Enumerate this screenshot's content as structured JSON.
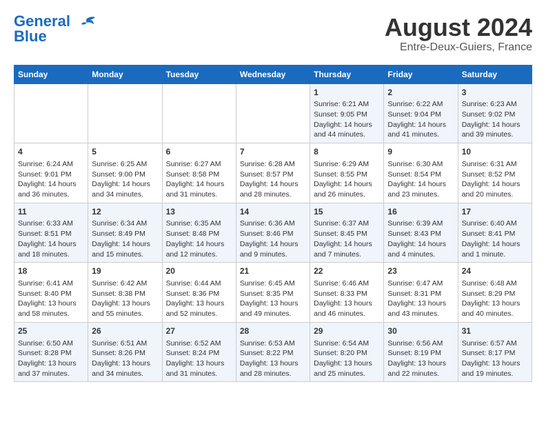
{
  "logo": {
    "line1": "General",
    "line2": "Blue"
  },
  "title": "August 2024",
  "subtitle": "Entre-Deux-Guiers, France",
  "weekdays": [
    "Sunday",
    "Monday",
    "Tuesday",
    "Wednesday",
    "Thursday",
    "Friday",
    "Saturday"
  ],
  "weeks": [
    [
      {
        "day": "",
        "content": ""
      },
      {
        "day": "",
        "content": ""
      },
      {
        "day": "",
        "content": ""
      },
      {
        "day": "",
        "content": ""
      },
      {
        "day": "1",
        "content": "Sunrise: 6:21 AM\nSunset: 9:05 PM\nDaylight: 14 hours and 44 minutes."
      },
      {
        "day": "2",
        "content": "Sunrise: 6:22 AM\nSunset: 9:04 PM\nDaylight: 14 hours and 41 minutes."
      },
      {
        "day": "3",
        "content": "Sunrise: 6:23 AM\nSunset: 9:02 PM\nDaylight: 14 hours and 39 minutes."
      }
    ],
    [
      {
        "day": "4",
        "content": "Sunrise: 6:24 AM\nSunset: 9:01 PM\nDaylight: 14 hours and 36 minutes."
      },
      {
        "day": "5",
        "content": "Sunrise: 6:25 AM\nSunset: 9:00 PM\nDaylight: 14 hours and 34 minutes."
      },
      {
        "day": "6",
        "content": "Sunrise: 6:27 AM\nSunset: 8:58 PM\nDaylight: 14 hours and 31 minutes."
      },
      {
        "day": "7",
        "content": "Sunrise: 6:28 AM\nSunset: 8:57 PM\nDaylight: 14 hours and 28 minutes."
      },
      {
        "day": "8",
        "content": "Sunrise: 6:29 AM\nSunset: 8:55 PM\nDaylight: 14 hours and 26 minutes."
      },
      {
        "day": "9",
        "content": "Sunrise: 6:30 AM\nSunset: 8:54 PM\nDaylight: 14 hours and 23 minutes."
      },
      {
        "day": "10",
        "content": "Sunrise: 6:31 AM\nSunset: 8:52 PM\nDaylight: 14 hours and 20 minutes."
      }
    ],
    [
      {
        "day": "11",
        "content": "Sunrise: 6:33 AM\nSunset: 8:51 PM\nDaylight: 14 hours and 18 minutes."
      },
      {
        "day": "12",
        "content": "Sunrise: 6:34 AM\nSunset: 8:49 PM\nDaylight: 14 hours and 15 minutes."
      },
      {
        "day": "13",
        "content": "Sunrise: 6:35 AM\nSunset: 8:48 PM\nDaylight: 14 hours and 12 minutes."
      },
      {
        "day": "14",
        "content": "Sunrise: 6:36 AM\nSunset: 8:46 PM\nDaylight: 14 hours and 9 minutes."
      },
      {
        "day": "15",
        "content": "Sunrise: 6:37 AM\nSunset: 8:45 PM\nDaylight: 14 hours and 7 minutes."
      },
      {
        "day": "16",
        "content": "Sunrise: 6:39 AM\nSunset: 8:43 PM\nDaylight: 14 hours and 4 minutes."
      },
      {
        "day": "17",
        "content": "Sunrise: 6:40 AM\nSunset: 8:41 PM\nDaylight: 14 hours and 1 minute."
      }
    ],
    [
      {
        "day": "18",
        "content": "Sunrise: 6:41 AM\nSunset: 8:40 PM\nDaylight: 13 hours and 58 minutes."
      },
      {
        "day": "19",
        "content": "Sunrise: 6:42 AM\nSunset: 8:38 PM\nDaylight: 13 hours and 55 minutes."
      },
      {
        "day": "20",
        "content": "Sunrise: 6:44 AM\nSunset: 8:36 PM\nDaylight: 13 hours and 52 minutes."
      },
      {
        "day": "21",
        "content": "Sunrise: 6:45 AM\nSunset: 8:35 PM\nDaylight: 13 hours and 49 minutes."
      },
      {
        "day": "22",
        "content": "Sunrise: 6:46 AM\nSunset: 8:33 PM\nDaylight: 13 hours and 46 minutes."
      },
      {
        "day": "23",
        "content": "Sunrise: 6:47 AM\nSunset: 8:31 PM\nDaylight: 13 hours and 43 minutes."
      },
      {
        "day": "24",
        "content": "Sunrise: 6:48 AM\nSunset: 8:29 PM\nDaylight: 13 hours and 40 minutes."
      }
    ],
    [
      {
        "day": "25",
        "content": "Sunrise: 6:50 AM\nSunset: 8:28 PM\nDaylight: 13 hours and 37 minutes."
      },
      {
        "day": "26",
        "content": "Sunrise: 6:51 AM\nSunset: 8:26 PM\nDaylight: 13 hours and 34 minutes."
      },
      {
        "day": "27",
        "content": "Sunrise: 6:52 AM\nSunset: 8:24 PM\nDaylight: 13 hours and 31 minutes."
      },
      {
        "day": "28",
        "content": "Sunrise: 6:53 AM\nSunset: 8:22 PM\nDaylight: 13 hours and 28 minutes."
      },
      {
        "day": "29",
        "content": "Sunrise: 6:54 AM\nSunset: 8:20 PM\nDaylight: 13 hours and 25 minutes."
      },
      {
        "day": "30",
        "content": "Sunrise: 6:56 AM\nSunset: 8:19 PM\nDaylight: 13 hours and 22 minutes."
      },
      {
        "day": "31",
        "content": "Sunrise: 6:57 AM\nSunset: 8:17 PM\nDaylight: 13 hours and 19 minutes."
      }
    ]
  ]
}
